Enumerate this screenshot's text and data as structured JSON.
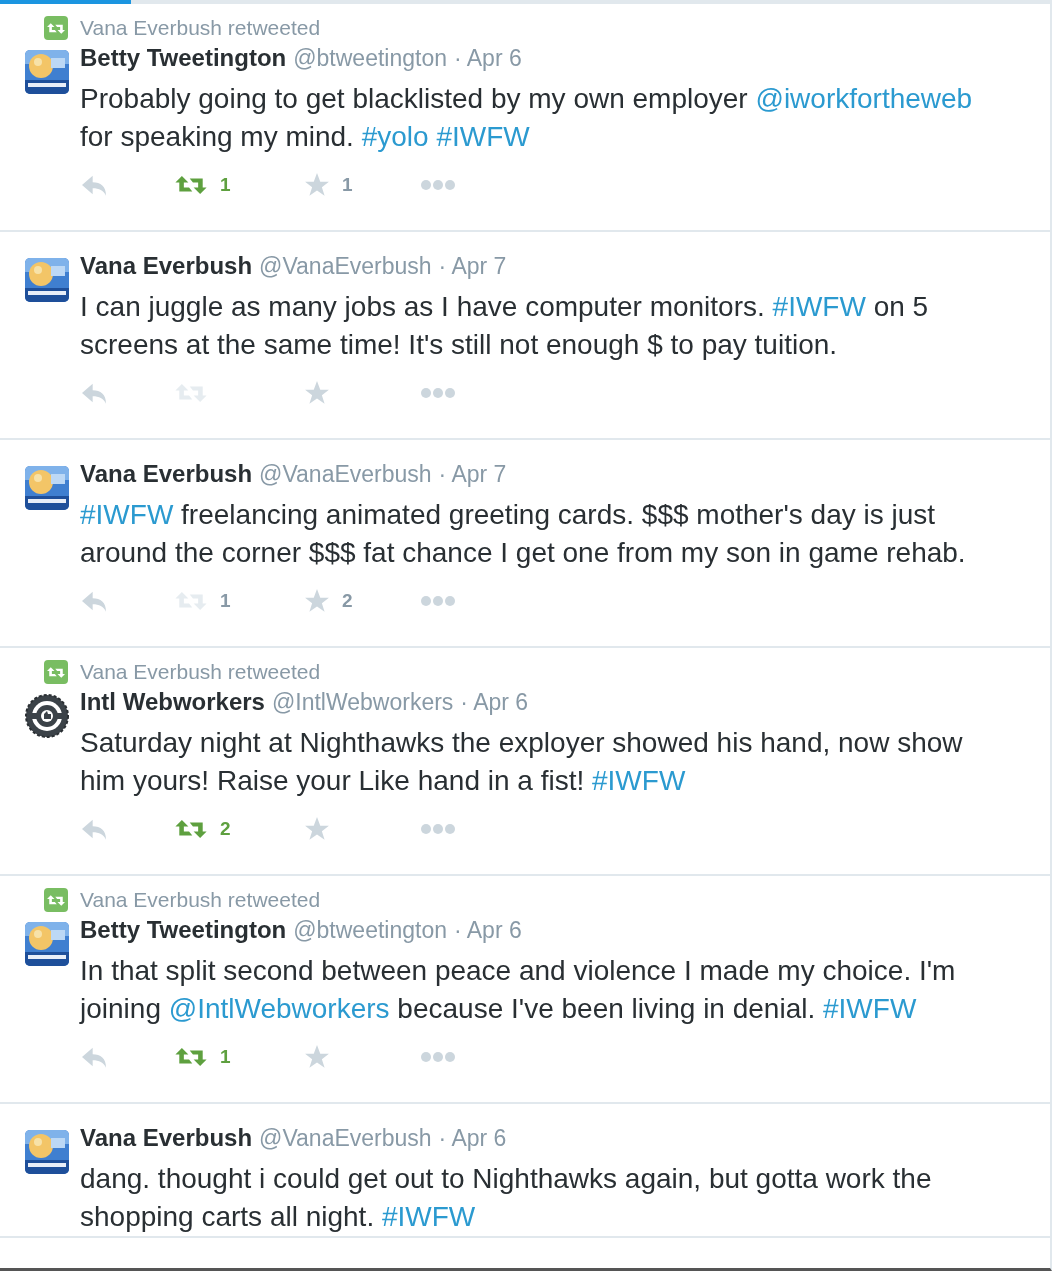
{
  "loading_bar": {
    "level": 0.125
  },
  "tweets": [
    {
      "retweeted_by": "Vana Everbush retweeted",
      "avatar": {
        "kind": "picture"
      },
      "name": "Betty Tweetington",
      "handle": "@btweetington",
      "date": "· Apr 6",
      "text": [
        {
          "kind": "text",
          "text": "Probably going to get blacklisted by my own employer "
        },
        {
          "kind": "link",
          "text": "@iworkfortheweb"
        },
        {
          "kind": "text",
          "text": " for speaking my mind. "
        },
        {
          "kind": "link",
          "text": "#yolo"
        },
        {
          "kind": "link",
          "text": "#IWFW"
        }
      ],
      "retweet": {
        "retweeted": true,
        "count": "1"
      },
      "favorite": {
        "count": "1"
      }
    },
    {
      "avatar": {
        "kind": "picture"
      },
      "name": "Vana Everbush",
      "handle": "@VanaEverbush",
      "date": "· Apr 7",
      "text": [
        {
          "kind": "text",
          "text": "I can juggle as many jobs as I have computer monitors. "
        },
        {
          "kind": "link",
          "text": "#IWFW"
        },
        {
          "kind": "text",
          "text": " on 5 screens at the same time!  It's still not enough $ to pay tuition."
        }
      ],
      "retweet": {
        "retweeted": false,
        "disabled": true
      }
    },
    {
      "avatar": {
        "kind": "picture"
      },
      "name": "Vana Everbush",
      "handle": "@VanaEverbush",
      "date": "· Apr 7",
      "text": [
        {
          "kind": "link",
          "text": "#IWFW"
        },
        {
          "kind": "text",
          "text": " freelancing animated greeting cards. $$$ mother's day is just around the corner $$$ fat chance I get one from my son in game rehab."
        }
      ],
      "retweet": {
        "retweeted": false,
        "disabled": true,
        "count": "1"
      },
      "favorite": {
        "count": "2"
      }
    },
    {
      "retweeted_by": "Vana Everbush retweeted",
      "avatar": {
        "kind": "badge"
      },
      "name": "Intl Webworkers",
      "handle": "@IntlWebworkers",
      "date": "· Apr 6",
      "text": [
        {
          "kind": "text",
          "text": "Saturday night at Nighthawks the exployer showed his hand, now show him yours! Raise your Like hand in a fist! "
        },
        {
          "kind": "link",
          "text": "#IWFW"
        }
      ],
      "retweet": {
        "retweeted": true,
        "count": "2"
      }
    },
    {
      "retweeted_by": "Vana Everbush retweeted",
      "avatar": {
        "kind": "picture"
      },
      "name": "Betty Tweetington",
      "handle": "@btweetington",
      "date": "· Apr 6",
      "text": [
        {
          "kind": "text",
          "text": "In that split second between peace and violence I made my choice. I'm joining "
        },
        {
          "kind": "link",
          "text": "@IntlWebworkers"
        },
        {
          "kind": "text",
          "text": " because I've been living in denial. "
        },
        {
          "kind": "link",
          "text": "#IWFW"
        }
      ],
      "retweet": {
        "retweeted": true,
        "count": "1"
      }
    },
    {
      "avatar": {
        "kind": "picture"
      },
      "name": "Vana Everbush",
      "handle": "@VanaEverbush",
      "date": "· Apr 6",
      "text": [
        {
          "kind": "text",
          "text": "dang. thought i could get out to Nighthawks again, but gotta work the shopping carts all night.  "
        },
        {
          "kind": "link",
          "text": "#IWFW"
        }
      ]
    }
  ]
}
